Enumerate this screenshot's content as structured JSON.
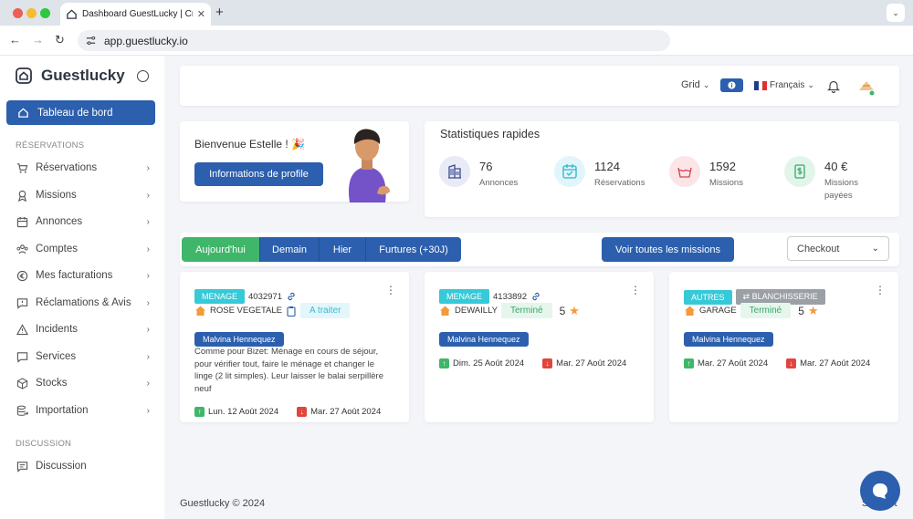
{
  "browser": {
    "tab_title": "Dashboard GuestLucky | Crea",
    "url": "app.guestlucky.io"
  },
  "sidebar": {
    "brand": "Guestlucky",
    "active": "Tableau de bord",
    "section_reservations": "RÉSERVATIONS",
    "items": [
      "Réservations",
      "Missions",
      "Annonces",
      "Comptes",
      "Mes facturations",
      "Réclamations & Avis",
      "Incidents",
      "Services",
      "Stocks",
      "Importation"
    ],
    "section_discussion": "DISCUSSION",
    "discussion": "Discussion"
  },
  "topbar": {
    "grid_label": "Grid",
    "language": "Français"
  },
  "welcome": {
    "greeting": "Bienvenue Estelle ! 🎉",
    "profile_button": "Informations de profile"
  },
  "stats": {
    "title": "Statistiques rapides",
    "items": [
      {
        "value": "76",
        "label": "Annonces"
      },
      {
        "value": "1124",
        "label": "Réservations"
      },
      {
        "value": "1592",
        "label": "Missions"
      },
      {
        "value": "40 €",
        "label": "Missions payées"
      }
    ]
  },
  "filters": {
    "tabs": [
      "Aujourd'hui",
      "Demain",
      "Hier",
      "Furtures (+30J)"
    ],
    "all_button": "Voir toutes les missions",
    "select_value": "Checkout"
  },
  "missions": [
    {
      "type": "MENAGE",
      "id": "4032971",
      "property": "ROSE VEGETALE",
      "status": "A traiter",
      "assignee": "Malvina Hennequez",
      "note": "Comme pour Bizet: Ménage en cours de séjour, pour vérifier tout, faire le ménage et changer le linge (2 lit simples). Leur laisser le balai serpillère neuf",
      "start": "Lun. 12 Août 2024",
      "end": "Mar. 27 Août 2024"
    },
    {
      "type": "MENAGE",
      "id": "4133892",
      "property": "DEWAILLY",
      "status": "Terminé",
      "rating": "5",
      "assignee": "Malvina Hennequez",
      "start": "Dim. 25 Août 2024",
      "end": "Mar. 27 Août 2024"
    },
    {
      "type": "AUTRES",
      "subtype": "BLANCHISSERIE",
      "property": "GARAGE",
      "status": "Terminé",
      "rating": "5",
      "assignee": "Malvina Hennequez",
      "start": "Mar. 27 Août 2024",
      "end": "Mar. 27 Août 2024"
    }
  ],
  "footer": {
    "copyright": "Guestlucky © 2024",
    "support": "Support"
  },
  "colors": {
    "primary": "#2c5fad",
    "success": "#3fb66a",
    "cyan": "#36c9d8"
  }
}
